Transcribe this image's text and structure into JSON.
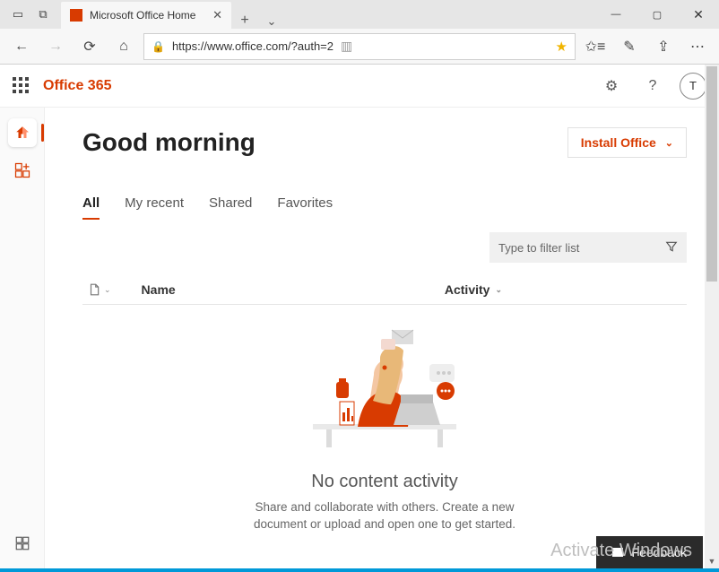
{
  "browser": {
    "tab_title": "Microsoft Office Home",
    "url": "https://www.office.com/?auth=2"
  },
  "header": {
    "brand": "Office 365",
    "avatar_initial": "T"
  },
  "greeting": "Good morning",
  "install_label": "Install Office",
  "doc_tabs": {
    "all": "All",
    "recent": "My recent",
    "shared": "Shared",
    "favorites": "Favorites"
  },
  "filter_placeholder": "Type to filter list",
  "columns": {
    "name": "Name",
    "activity": "Activity"
  },
  "empty_state": {
    "title": "No content activity",
    "body": "Share and collaborate with others. Create a new document or upload and open one to get started."
  },
  "feedback_label": "Feedback",
  "watermark": "Activate Windows"
}
